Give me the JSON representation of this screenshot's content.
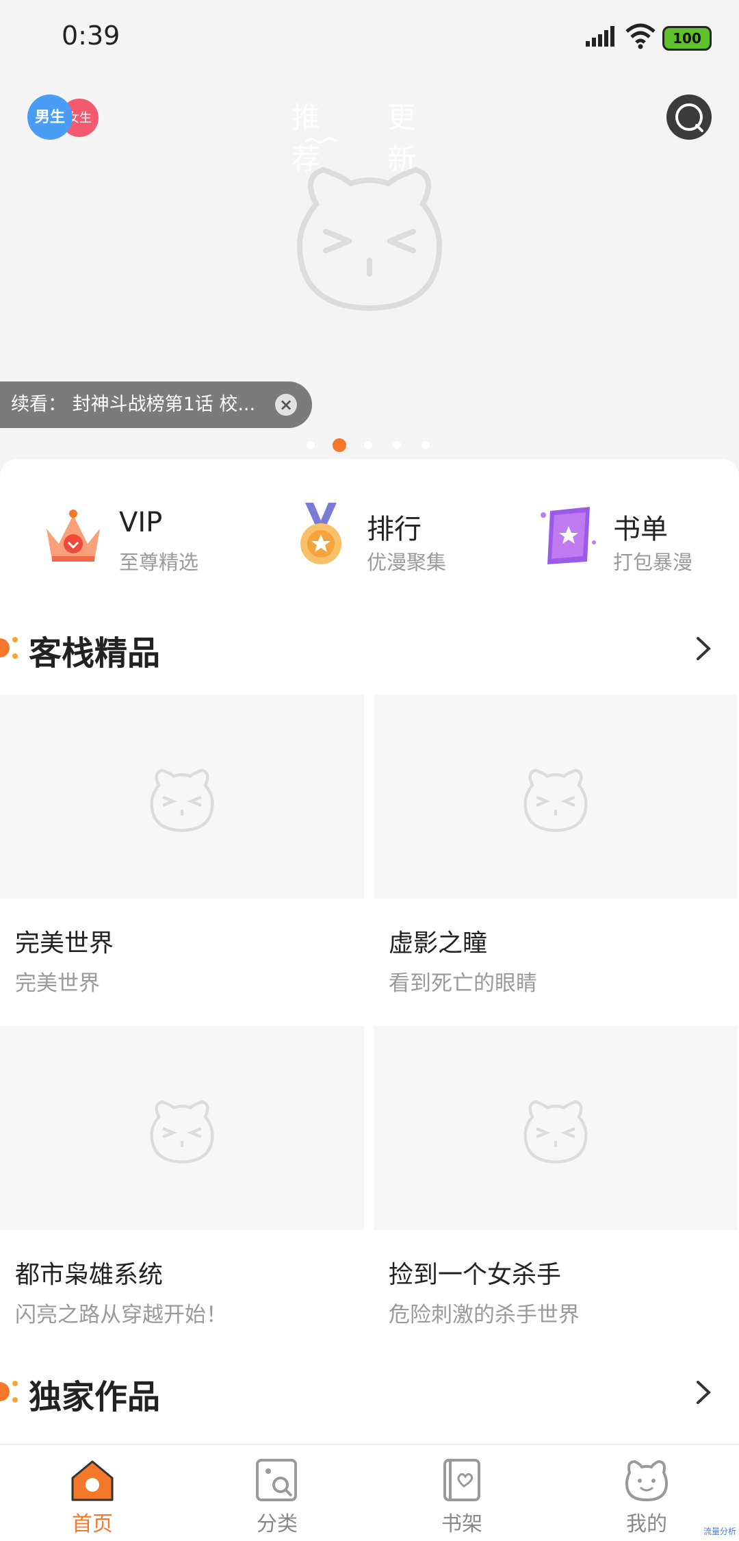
{
  "status_bar": {
    "time": "0:39",
    "battery": "100"
  },
  "header": {
    "gender_boy": "男生",
    "gender_girl": "女生",
    "tabs": [
      {
        "label": "推荐"
      },
      {
        "label": "更新"
      }
    ]
  },
  "banner": {
    "continue_text": "续看： 封神斗战榜第1话 校...",
    "dot_count": 5,
    "active_dot": 1
  },
  "quick_links": [
    {
      "title": "VIP",
      "subtitle": "至尊精选",
      "icon": "crown-icon"
    },
    {
      "title": "排行",
      "subtitle": "优漫聚集",
      "icon": "medal-icon"
    },
    {
      "title": "书单",
      "subtitle": "打包暴漫",
      "icon": "book-icon"
    }
  ],
  "sections": [
    {
      "title": "客栈精品",
      "items": [
        {
          "name": "完美世界",
          "desc": "完美世界"
        },
        {
          "name": "虚影之瞳",
          "desc": "看到死亡的眼睛"
        },
        {
          "name": "都市枭雄系统",
          "desc": "闪亮之路从穿越开始！"
        },
        {
          "name": "捡到一个女杀手",
          "desc": "危险刺激的杀手世界"
        }
      ]
    },
    {
      "title": "独家作品",
      "items": []
    }
  ],
  "bottom_nav": [
    {
      "label": "首页",
      "icon": "home-icon",
      "active": true
    },
    {
      "label": "分类",
      "icon": "category-icon",
      "active": false
    },
    {
      "label": "书架",
      "icon": "bookshelf-icon",
      "active": false
    },
    {
      "label": "我的",
      "icon": "profile-icon",
      "active": false
    }
  ],
  "watermark": "流量分析",
  "colors": {
    "accent": "#f5782a",
    "boy": "#4a9df4",
    "girl": "#f45a6d"
  }
}
